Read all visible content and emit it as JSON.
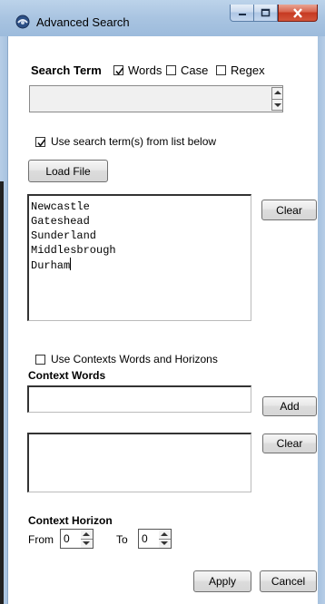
{
  "window": {
    "title": "Advanced Search"
  },
  "search_term": {
    "label": "Search Term",
    "words_label": "Words",
    "words_checked": true,
    "case_label": "Case",
    "case_checked": false,
    "regex_label": "Regex",
    "regex_checked": false,
    "value": ""
  },
  "term_list": {
    "use_label": "Use search term(s) from list below",
    "use_checked": true,
    "load_button": "Load File",
    "clear_button": "Clear",
    "items": [
      "Newcastle",
      "Gateshead",
      "Sunderland",
      "Middlesbrough",
      "Durham"
    ]
  },
  "context": {
    "use_label": "Use Contexts Words and Horizons",
    "use_checked": false,
    "words_heading": "Context Words",
    "word_input": "",
    "add_button": "Add",
    "clear_button": "Clear",
    "horizon_heading": "Context Horizon",
    "from_label": "From",
    "from_value": "0",
    "to_label": "To",
    "to_value": "0"
  },
  "footer": {
    "apply_button": "Apply",
    "cancel_button": "Cancel"
  }
}
